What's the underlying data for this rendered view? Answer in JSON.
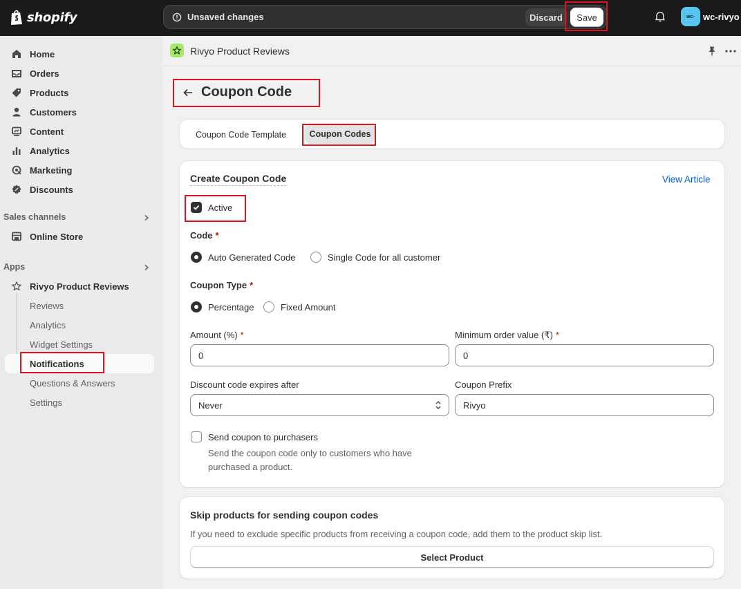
{
  "topbar": {
    "brand": "shopify",
    "unsaved_text": "Unsaved changes",
    "discard_label": "Discard",
    "save_label": "Save",
    "avatar_initials": "wc-",
    "store_name": "wc-rivyo"
  },
  "sidebar": {
    "items": [
      {
        "label": "Home",
        "icon": "home-icon"
      },
      {
        "label": "Orders",
        "icon": "orders-icon"
      },
      {
        "label": "Products",
        "icon": "tag-icon"
      },
      {
        "label": "Customers",
        "icon": "person-icon"
      },
      {
        "label": "Content",
        "icon": "content-icon"
      },
      {
        "label": "Analytics",
        "icon": "bar-chart-icon"
      },
      {
        "label": "Marketing",
        "icon": "target-icon"
      },
      {
        "label": "Discounts",
        "icon": "discount-icon"
      }
    ],
    "sales_channels_title": "Sales channels",
    "online_store": "Online Store",
    "apps_title": "Apps",
    "app_name": "Rivyo Product Reviews",
    "app_subitems": [
      "Reviews",
      "Analytics",
      "Widget Settings",
      "Notifications",
      "Questions & Answers",
      "Settings"
    ]
  },
  "appbar": {
    "title": "Rivyo Product Reviews"
  },
  "page": {
    "title": "Coupon Code",
    "tabs": [
      "Coupon Code Template",
      "Coupon Codes"
    ],
    "active_tab": "Coupon Codes"
  },
  "form": {
    "card_title": "Create Coupon Code",
    "view_article": "View Article",
    "active_label": "Active",
    "active_checked": true,
    "code_label": "Code",
    "code_options": [
      "Auto Generated Code",
      "Single Code for all customer"
    ],
    "code_selected": "Auto Generated Code",
    "coupon_type_label": "Coupon Type",
    "type_options": [
      "Percentage",
      "Fixed Amount"
    ],
    "type_selected": "Percentage",
    "amount_label": "Amount (%)",
    "amount_value": "0",
    "min_order_label": "Minimum order value (₹)",
    "min_order_value": "0",
    "expires_label": "Discount code expires after",
    "expires_value": "Never",
    "prefix_label": "Coupon Prefix",
    "prefix_value": "Rivyo",
    "send_label": "Send coupon to purchasers",
    "send_checked": false,
    "send_help": "Send the coupon code only to customers who have purchased a product.",
    "required_mark": "*"
  },
  "skip": {
    "title": "Skip products for sending coupon codes",
    "description": "If you need to exclude specific products from receiving a coupon code, add them to the product skip list.",
    "button_label": "Select Product"
  },
  "colors": {
    "topbar": "#1a1a1a",
    "highlight": "#e0121e",
    "link": "#005bd3",
    "app_icon": "#a7e86b"
  }
}
